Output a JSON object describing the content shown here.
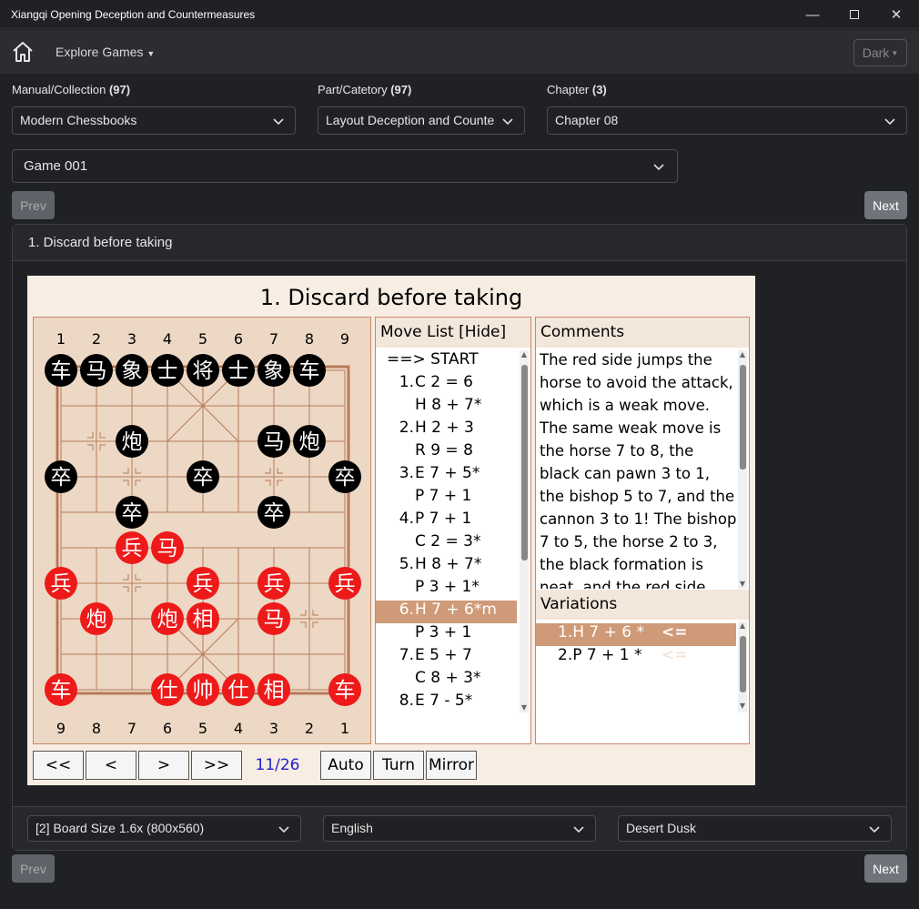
{
  "window": {
    "title": "Xiangqi Opening Deception and Countermeasures"
  },
  "navbar": {
    "explore": "Explore Games",
    "theme": "Dark"
  },
  "filters": {
    "manual": {
      "label": "Manual/Collection",
      "count": "(97)",
      "value": "Modern Chessbooks"
    },
    "part": {
      "label": "Part/Catetory",
      "count": "(97)",
      "value": "Layout Deception and Counte"
    },
    "chapter": {
      "label": "Chapter",
      "count": "(3)",
      "value": "Chapter 08"
    }
  },
  "game": {
    "value": "Game 001"
  },
  "nav": {
    "prev": "Prev",
    "next": "Next"
  },
  "card": {
    "title": "1. Discard before taking"
  },
  "board": {
    "title": "1. Discard before taking",
    "top_numbers": [
      "1",
      "2",
      "3",
      "4",
      "5",
      "6",
      "7",
      "8",
      "9"
    ],
    "bottom_numbers": [
      "9",
      "8",
      "7",
      "6",
      "5",
      "4",
      "3",
      "2",
      "1"
    ],
    "pieces": [
      {
        "side": "black",
        "char": "车",
        "file": 0,
        "rank": 0
      },
      {
        "side": "black",
        "char": "马",
        "file": 1,
        "rank": 0
      },
      {
        "side": "black",
        "char": "象",
        "file": 2,
        "rank": 0
      },
      {
        "side": "black",
        "char": "士",
        "file": 3,
        "rank": 0
      },
      {
        "side": "black",
        "char": "将",
        "file": 4,
        "rank": 0
      },
      {
        "side": "black",
        "char": "士",
        "file": 5,
        "rank": 0
      },
      {
        "side": "black",
        "char": "象",
        "file": 6,
        "rank": 0
      },
      {
        "side": "black",
        "char": "车",
        "file": 7,
        "rank": 0
      },
      {
        "side": "black",
        "char": "炮",
        "file": 2,
        "rank": 2
      },
      {
        "side": "black",
        "char": "马",
        "file": 6,
        "rank": 2
      },
      {
        "side": "black",
        "char": "炮",
        "file": 7,
        "rank": 2
      },
      {
        "side": "black",
        "char": "卒",
        "file": 0,
        "rank": 3
      },
      {
        "side": "black",
        "char": "卒",
        "file": 4,
        "rank": 3
      },
      {
        "side": "black",
        "char": "卒",
        "file": 8,
        "rank": 3
      },
      {
        "side": "black",
        "char": "卒",
        "file": 2,
        "rank": 4
      },
      {
        "side": "black",
        "char": "卒",
        "file": 6,
        "rank": 4
      },
      {
        "side": "red",
        "char": "兵",
        "file": 2,
        "rank": 5
      },
      {
        "side": "red",
        "char": "马",
        "file": 3,
        "rank": 5
      },
      {
        "side": "red",
        "char": "兵",
        "file": 0,
        "rank": 6
      },
      {
        "side": "red",
        "char": "兵",
        "file": 4,
        "rank": 6
      },
      {
        "side": "red",
        "char": "兵",
        "file": 6,
        "rank": 6
      },
      {
        "side": "red",
        "char": "兵",
        "file": 8,
        "rank": 6
      },
      {
        "side": "red",
        "char": "炮",
        "file": 1,
        "rank": 7
      },
      {
        "side": "red",
        "char": "炮",
        "file": 3,
        "rank": 7
      },
      {
        "side": "red",
        "char": "相",
        "file": 4,
        "rank": 7
      },
      {
        "side": "red",
        "char": "马",
        "file": 6,
        "rank": 7
      },
      {
        "side": "red",
        "char": "车",
        "file": 0,
        "rank": 9
      },
      {
        "side": "red",
        "char": "仕",
        "file": 3,
        "rank": 9
      },
      {
        "side": "red",
        "char": "帅",
        "file": 4,
        "rank": 9
      },
      {
        "side": "red",
        "char": "仕",
        "file": 5,
        "rank": 9
      },
      {
        "side": "red",
        "char": "相",
        "file": 6,
        "rank": 9
      },
      {
        "side": "red",
        "char": "车",
        "file": 8,
        "rank": 9
      }
    ],
    "markers": [
      {
        "file": 1,
        "rank": 2
      },
      {
        "file": 2,
        "rank": 3
      },
      {
        "file": 6,
        "rank": 3
      },
      {
        "file": 2,
        "rank": 6
      },
      {
        "file": 7,
        "rank": 7
      }
    ]
  },
  "moves": {
    "header": "Move List [Hide]",
    "items": [
      {
        "num": "",
        "text": "==> START"
      },
      {
        "num": "1.",
        "text": "C 2 = 6"
      },
      {
        "num": "",
        "text": "H 8 + 7*"
      },
      {
        "num": "2.",
        "text": "H 2 + 3"
      },
      {
        "num": "",
        "text": "R 9 = 8"
      },
      {
        "num": "3.",
        "text": "E 7 + 5*"
      },
      {
        "num": "",
        "text": "P 7 + 1"
      },
      {
        "num": "4.",
        "text": "P 7 + 1"
      },
      {
        "num": "",
        "text": "C 2 = 3*"
      },
      {
        "num": "5.",
        "text": "H 8 + 7*"
      },
      {
        "num": "",
        "text": "P 3 + 1*"
      },
      {
        "num": "6.",
        "text": "H 7 + 6*m"
      },
      {
        "num": "",
        "text": "P 3 + 1"
      },
      {
        "num": "7.",
        "text": "E 5 + 7"
      },
      {
        "num": "",
        "text": "C 8 + 3*"
      },
      {
        "num": "8.",
        "text": "E 7 - 5*"
      }
    ],
    "current_index": 11
  },
  "comments": {
    "header": "Comments",
    "text": "The red side jumps the horse to avoid the attack, which is a weak move. The same weak move is the horse 7 to 8, the black can pawn 3 to 1, the bishop 5 to 7, and the cannon 3 to 1! The bishop 7 to 5, the horse 2 to 3, the black formation is neat, and the red side loses the initiative."
  },
  "variations": {
    "header": "Variations",
    "items": [
      {
        "num": "1.",
        "text": "H 7 + 6 *",
        "mark": "<="
      },
      {
        "num": "2.",
        "text": "P 7 + 1 *",
        "mark": "<="
      }
    ],
    "current_index": 0
  },
  "controls": {
    "first": "<<",
    "prev": "<",
    "next": ">",
    "last": ">>",
    "counter": "11/26",
    "auto": "Auto",
    "turn": "Turn",
    "mirror": "Mirror"
  },
  "footer": {
    "board_size": "[2] Board Size 1.6x (800x560)",
    "language": "English",
    "theme": "Desert Dusk"
  },
  "colors": {
    "red_piece": "#ee1a1a",
    "black_piece": "#000000",
    "board_line": "#b87a5a",
    "highlight": "#cf9a78",
    "counter": "#2222cc"
  }
}
